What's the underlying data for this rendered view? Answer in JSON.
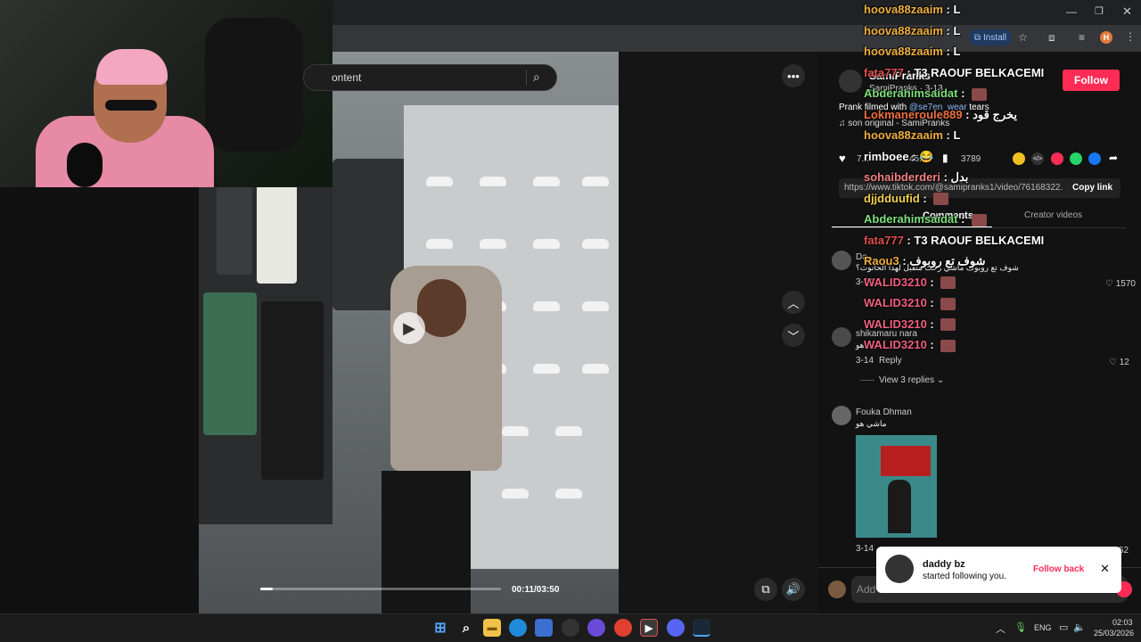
{
  "browser": {
    "install_label": "Install",
    "profile_letter": "H",
    "window_controls": [
      "minimize",
      "restore",
      "close"
    ]
  },
  "search": {
    "placeholder_partial": "ontent"
  },
  "video": {
    "time_label": "00:11/03:50",
    "progress_fraction": 0.05
  },
  "post": {
    "author": "SamiPranks",
    "author_sub": "SamiPranks · 3-13",
    "follow_label": "Follow",
    "caption_pre": "Prank filmed with",
    "caption_link": "@se7en_wear",
    "caption_post": "tears",
    "sound": "son original - SamiPranks",
    "likes": "7...",
    "comments": "45...",
    "saves": "3789",
    "link_url": "https://www.tiktok.com/@samipranks1/video/76168322...",
    "copy_link_label": "Copy link",
    "tab_comments": "Comments",
    "tab_creator": "Creator videos"
  },
  "comments": [
    {
      "user": "Da...",
      "text": "شوف تع روبوف ماشي رحت متقبل لهدا الحانوت؟",
      "date": "3-14",
      "likes": "1570"
    },
    {
      "user": "shikamaru nara",
      "text": "هو",
      "date": "3-14",
      "reply_label": "Reply",
      "likes": "12",
      "replies_label": "View 3 replies"
    },
    {
      "user": "Fouka Dhman",
      "text": "ماشي هو",
      "date": "3-14",
      "likes": "52"
    }
  ],
  "comment_input_placeholder": "Add comment...",
  "chat_overlay": [
    {
      "user": "hoova88zaaim",
      "color": "#f0b040",
      "msg": "L",
      "emoji": false
    },
    {
      "user": "hoova88zaaim",
      "color": "#f0b040",
      "msg": "L",
      "emoji": false
    },
    {
      "user": "hoova88zaaim",
      "color": "#f0b040",
      "msg": "L",
      "emoji": false
    },
    {
      "user": "fata777",
      "color": "#e05050",
      "msg": "T3 RAOUF BELKACEMI",
      "emoji": false
    },
    {
      "user": "Abderahimsaidat",
      "color": "#7de07d",
      "msg": "",
      "emoji": true
    },
    {
      "user": "Lokmaneroule889",
      "color": "#f07040",
      "msg": "يخرج قود",
      "emoji": false
    },
    {
      "user": "hoova88zaaim",
      "color": "#f0b040",
      "msg": "L",
      "emoji": false
    },
    {
      "user": "rimboee",
      "color": "#ffffff",
      "msg": "😂",
      "emoji": false
    },
    {
      "user": "sohaibderderi",
      "color": "#f08080",
      "msg": "بدل",
      "emoji": false
    },
    {
      "user": "djjdduufid",
      "color": "#f0d050",
      "msg": "",
      "emoji": true
    },
    {
      "user": "Abderahimsaidat",
      "color": "#7de07d",
      "msg": "",
      "emoji": true
    },
    {
      "user": "fata777",
      "color": "#e05050",
      "msg": "T3 RAOUF BELKACEMI",
      "emoji": false
    },
    {
      "user": "Raou3",
      "color": "#f0b040",
      "msg": "شوف تع روبوف",
      "emoji": false
    },
    {
      "user": "WALID3210",
      "color": "#f06080",
      "msg": "",
      "emoji": true
    },
    {
      "user": "WALID3210",
      "color": "#f06080",
      "msg": "",
      "emoji": true
    },
    {
      "user": "WALID3210",
      "color": "#f06080",
      "msg": "",
      "emoji": true
    },
    {
      "user": "WALID3210",
      "color": "#f06080",
      "msg": "",
      "emoji": true
    }
  ],
  "toast": {
    "user": "daddy bz",
    "text": "started following you.",
    "action": "Follow back"
  },
  "taskbar": {
    "lang": "ENG",
    "time": "02:03",
    "date": "25/03/2026"
  },
  "colors": {
    "accent": "#fe2c55",
    "background": "#121212"
  }
}
